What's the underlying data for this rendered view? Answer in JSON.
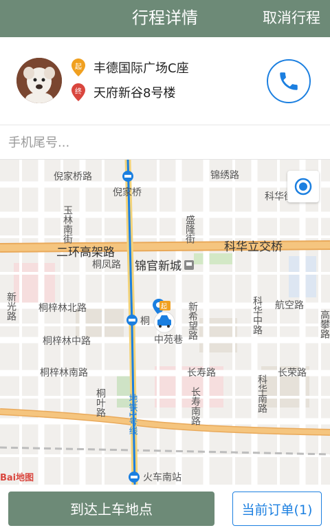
{
  "header": {
    "title": "行程详情",
    "cancel_label": "取消行程",
    "bg_color": "#6d8a77"
  },
  "trip": {
    "start_marker": "起",
    "start_address": "丰德国际广场C座",
    "end_marker": "终",
    "end_address": "天府新谷8号楼"
  },
  "phone_input": {
    "placeholder": "手机尾号...",
    "value": ""
  },
  "map": {
    "labels": {
      "nijiaqiao_road": "倪家桥路",
      "nijiaqiao_station": "倪家桥",
      "jinxiu_road": "锦绣路",
      "kehua_road_top": "科华街",
      "yulin_south_street": "玉林南街",
      "shenglong_street": "盛隆街",
      "second_ring": "二环高架路",
      "kehua_interchange": "科华立交桥",
      "tongfeng_road": "桐凤路",
      "jinguan_xincheng": "锦官新城",
      "xinguang_road": "新光路",
      "tongzilin_north": "桐梓林北路",
      "tongzilin_station": "桐",
      "xinxiwang_road": "新希望路",
      "kehua_middle": "科华中路",
      "hangkong_road": "航空路",
      "gaopeng_road": "高攀路",
      "tongzilin_middle": "桐梓林中路",
      "zhongyuan_lane": "中苑巷",
      "tongzilin_south": "桐梓林南路",
      "changshou_road": "长寿路",
      "changrong_road": "长荣路",
      "tongye_road": "桐叶路",
      "changshou_south": "长寿南路",
      "kehua_south": "科华南路",
      "metro_line1": "地铁1号线",
      "huochenan_station": "火车南站",
      "baidu_logo": "Bai地图",
      "start_pin": "起"
    }
  },
  "actions": {
    "arrive_label": "到达上车地点",
    "current_order_label": "当前订单(1)"
  },
  "colors": {
    "accent_blue": "#1b7fe0",
    "start_pin": "#f0a020",
    "end_pin": "#d9463e",
    "ring_road": "#f5b867"
  }
}
